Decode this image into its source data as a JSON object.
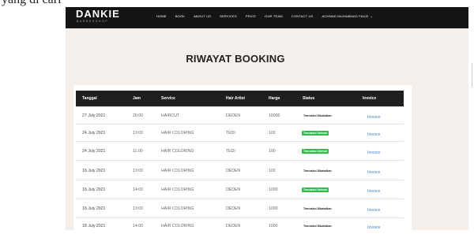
{
  "top_fragment": "yang di cari",
  "brand": {
    "name": "DANKIE",
    "tagline": "BARBERSHOP"
  },
  "nav": [
    {
      "label": "HOME"
    },
    {
      "label": "BOOK"
    },
    {
      "label": "ABOUT US"
    },
    {
      "label": "SERVICES"
    },
    {
      "label": "PRICE"
    },
    {
      "label": "OUR TEAM"
    },
    {
      "label": "CONTACT US"
    },
    {
      "label": "ACHMAD MUHAMMAD FAUZI"
    }
  ],
  "page_title": "RIWAYAT BOOKING",
  "table": {
    "headers": [
      "Tanggal",
      "Jam",
      "Service",
      "Hair Artist",
      "Harga",
      "Status",
      "Invoice"
    ],
    "rows": [
      {
        "tanggal": "27 July 2021",
        "jam": "20:00",
        "service": "HAIRCUT",
        "artist": "DEDEN",
        "harga": "10000",
        "status": "Transaksi Dibatalkan",
        "status_type": "plain",
        "invoice": "Invoice"
      },
      {
        "tanggal": "24 July 2021",
        "jam": "13:00",
        "service": "HAIR COLORING",
        "artist": "TEDI",
        "harga": "100",
        "status": "Transaksi Selesai",
        "status_type": "green",
        "invoice": "Invoice"
      },
      {
        "tanggal": "24 July 2021",
        "jam": "11:00",
        "service": "HAIR COLORING",
        "artist": "TEDI",
        "harga": "100",
        "status": "Transaksi Selesai",
        "status_type": "green",
        "invoice": "Invoice"
      },
      {
        "tanggal": "18 July 2021",
        "jam": "13:00",
        "service": "HAIR COLORING",
        "artist": "DEDEN",
        "harga": "100",
        "status": "Transaksi Dibatalkan",
        "status_type": "plain",
        "invoice": "Invoice"
      },
      {
        "tanggal": "18 July 2021",
        "jam": "14:00",
        "service": "HAIR COLORING",
        "artist": "DEDEN",
        "harga": "1000",
        "status": "Transaksi Selesai",
        "status_type": "green",
        "invoice": "Invoice"
      },
      {
        "tanggal": "18 July 2021",
        "jam": "13:00",
        "service": "HAIR COLORING",
        "artist": "DEDEN",
        "harga": "1000",
        "status": "Transaksi Dibatalkan",
        "status_type": "plain",
        "invoice": "Invoice"
      },
      {
        "tanggal": "18 July 2021",
        "jam": "14:00",
        "service": "HAIR COLORING",
        "artist": "DEDEN",
        "harga": "1000",
        "status": "Transaksi Dibatalkan",
        "status_type": "plain",
        "invoice": "Invoice"
      }
    ]
  },
  "colors": {
    "navbar": "#151515",
    "background": "#f5efec",
    "table_header": "#1f1f1f",
    "status_done": "#2fbd4a",
    "link": "#3d7fd9"
  }
}
